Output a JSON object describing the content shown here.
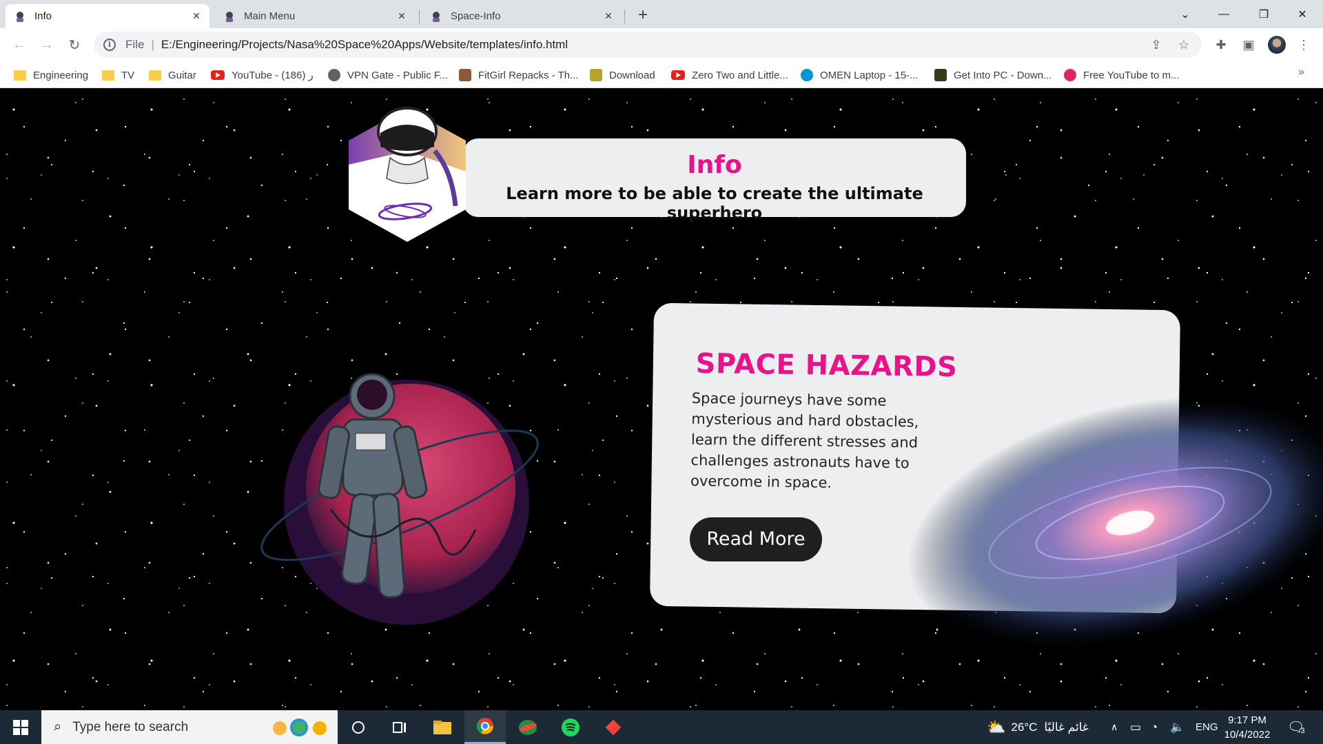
{
  "browser": {
    "tabs": [
      {
        "label": "Info",
        "active": true
      },
      {
        "label": "Main Menu",
        "active": false
      },
      {
        "label": "Space-Info",
        "active": false
      }
    ],
    "address": {
      "scheme": "File",
      "url": "E:/Engineering/Projects/Nasa%20Space%20Apps/Website/templates/info.html"
    },
    "bookmarks": [
      {
        "label": "Engineering",
        "icon": "folder-icon"
      },
      {
        "label": "TV",
        "icon": "folder-icon"
      },
      {
        "label": "Guitar",
        "icon": "folder-icon"
      },
      {
        "label": "YouTube - ر (186)",
        "icon": "youtube-icon"
      },
      {
        "label": "VPN Gate - Public F...",
        "icon": "globe-icon"
      },
      {
        "label": "FitGirl Repacks - Th...",
        "icon": "fitgirl-icon"
      },
      {
        "label": "Download",
        "icon": "download-icon"
      },
      {
        "label": "Zero Two and Little...",
        "icon": "youtube-icon"
      },
      {
        "label": "OMEN Laptop - 15-...",
        "icon": "hp-icon"
      },
      {
        "label": "Get Into PC - Down...",
        "icon": "getintopc-icon"
      },
      {
        "label": "Free YouTube to m...",
        "icon": "converter-icon"
      }
    ]
  },
  "page": {
    "header": {
      "title": "Info",
      "subtitle": "Learn more to be able to create the ultimate superhero"
    },
    "hazard": {
      "title": "SPACE HAZARDS",
      "body": "Space journeys have some mysterious and hard obstacles, learn the different stresses and challenges astronauts have to overcome in space.",
      "button": "Read More"
    }
  },
  "taskbar": {
    "search_placeholder": "Type here to search",
    "weather": "26°C",
    "weather_text": "غائم غالبًا",
    "language": "ENG",
    "time": "9:17 PM",
    "date": "10/4/2022",
    "notifications": "3"
  },
  "colors": {
    "accent": "#e8128b",
    "card": "#eceef0",
    "button": "#1f1f1f"
  }
}
